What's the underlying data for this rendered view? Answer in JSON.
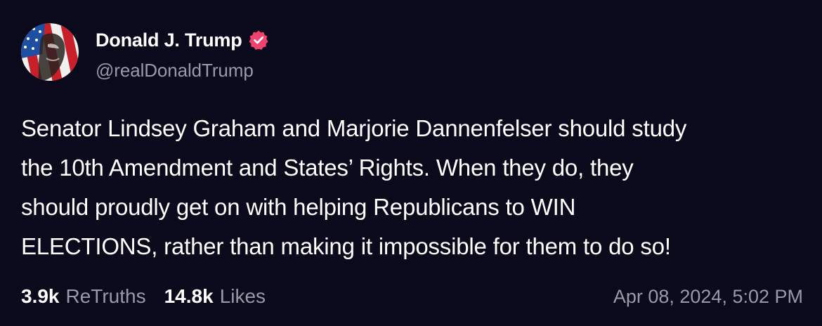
{
  "author": {
    "display_name": "Donald J. Trump",
    "handle": "@realDonaldTrump",
    "verified_icon": "verified-badge-icon",
    "avatar_icon": "profile-avatar"
  },
  "post": {
    "text": "Senator Lindsey Graham and Marjorie Dannenfelser should study\nthe 10th Amendment and States’ Rights. When they do, they\nshould proudly get on with helping Republicans to WIN\nELECTIONS, rather than making it impossible for them to do so!"
  },
  "stats": {
    "retruths_count": "3.9k",
    "retruths_label": "ReTruths",
    "likes_count": "14.8k",
    "likes_label": "Likes"
  },
  "timestamp": "Apr 08, 2024, 5:02 PM",
  "colors": {
    "background": "#0b0a1c",
    "text_primary": "#ffffff",
    "text_secondary": "#9a99a8",
    "verified_badge": "#f0426e"
  }
}
